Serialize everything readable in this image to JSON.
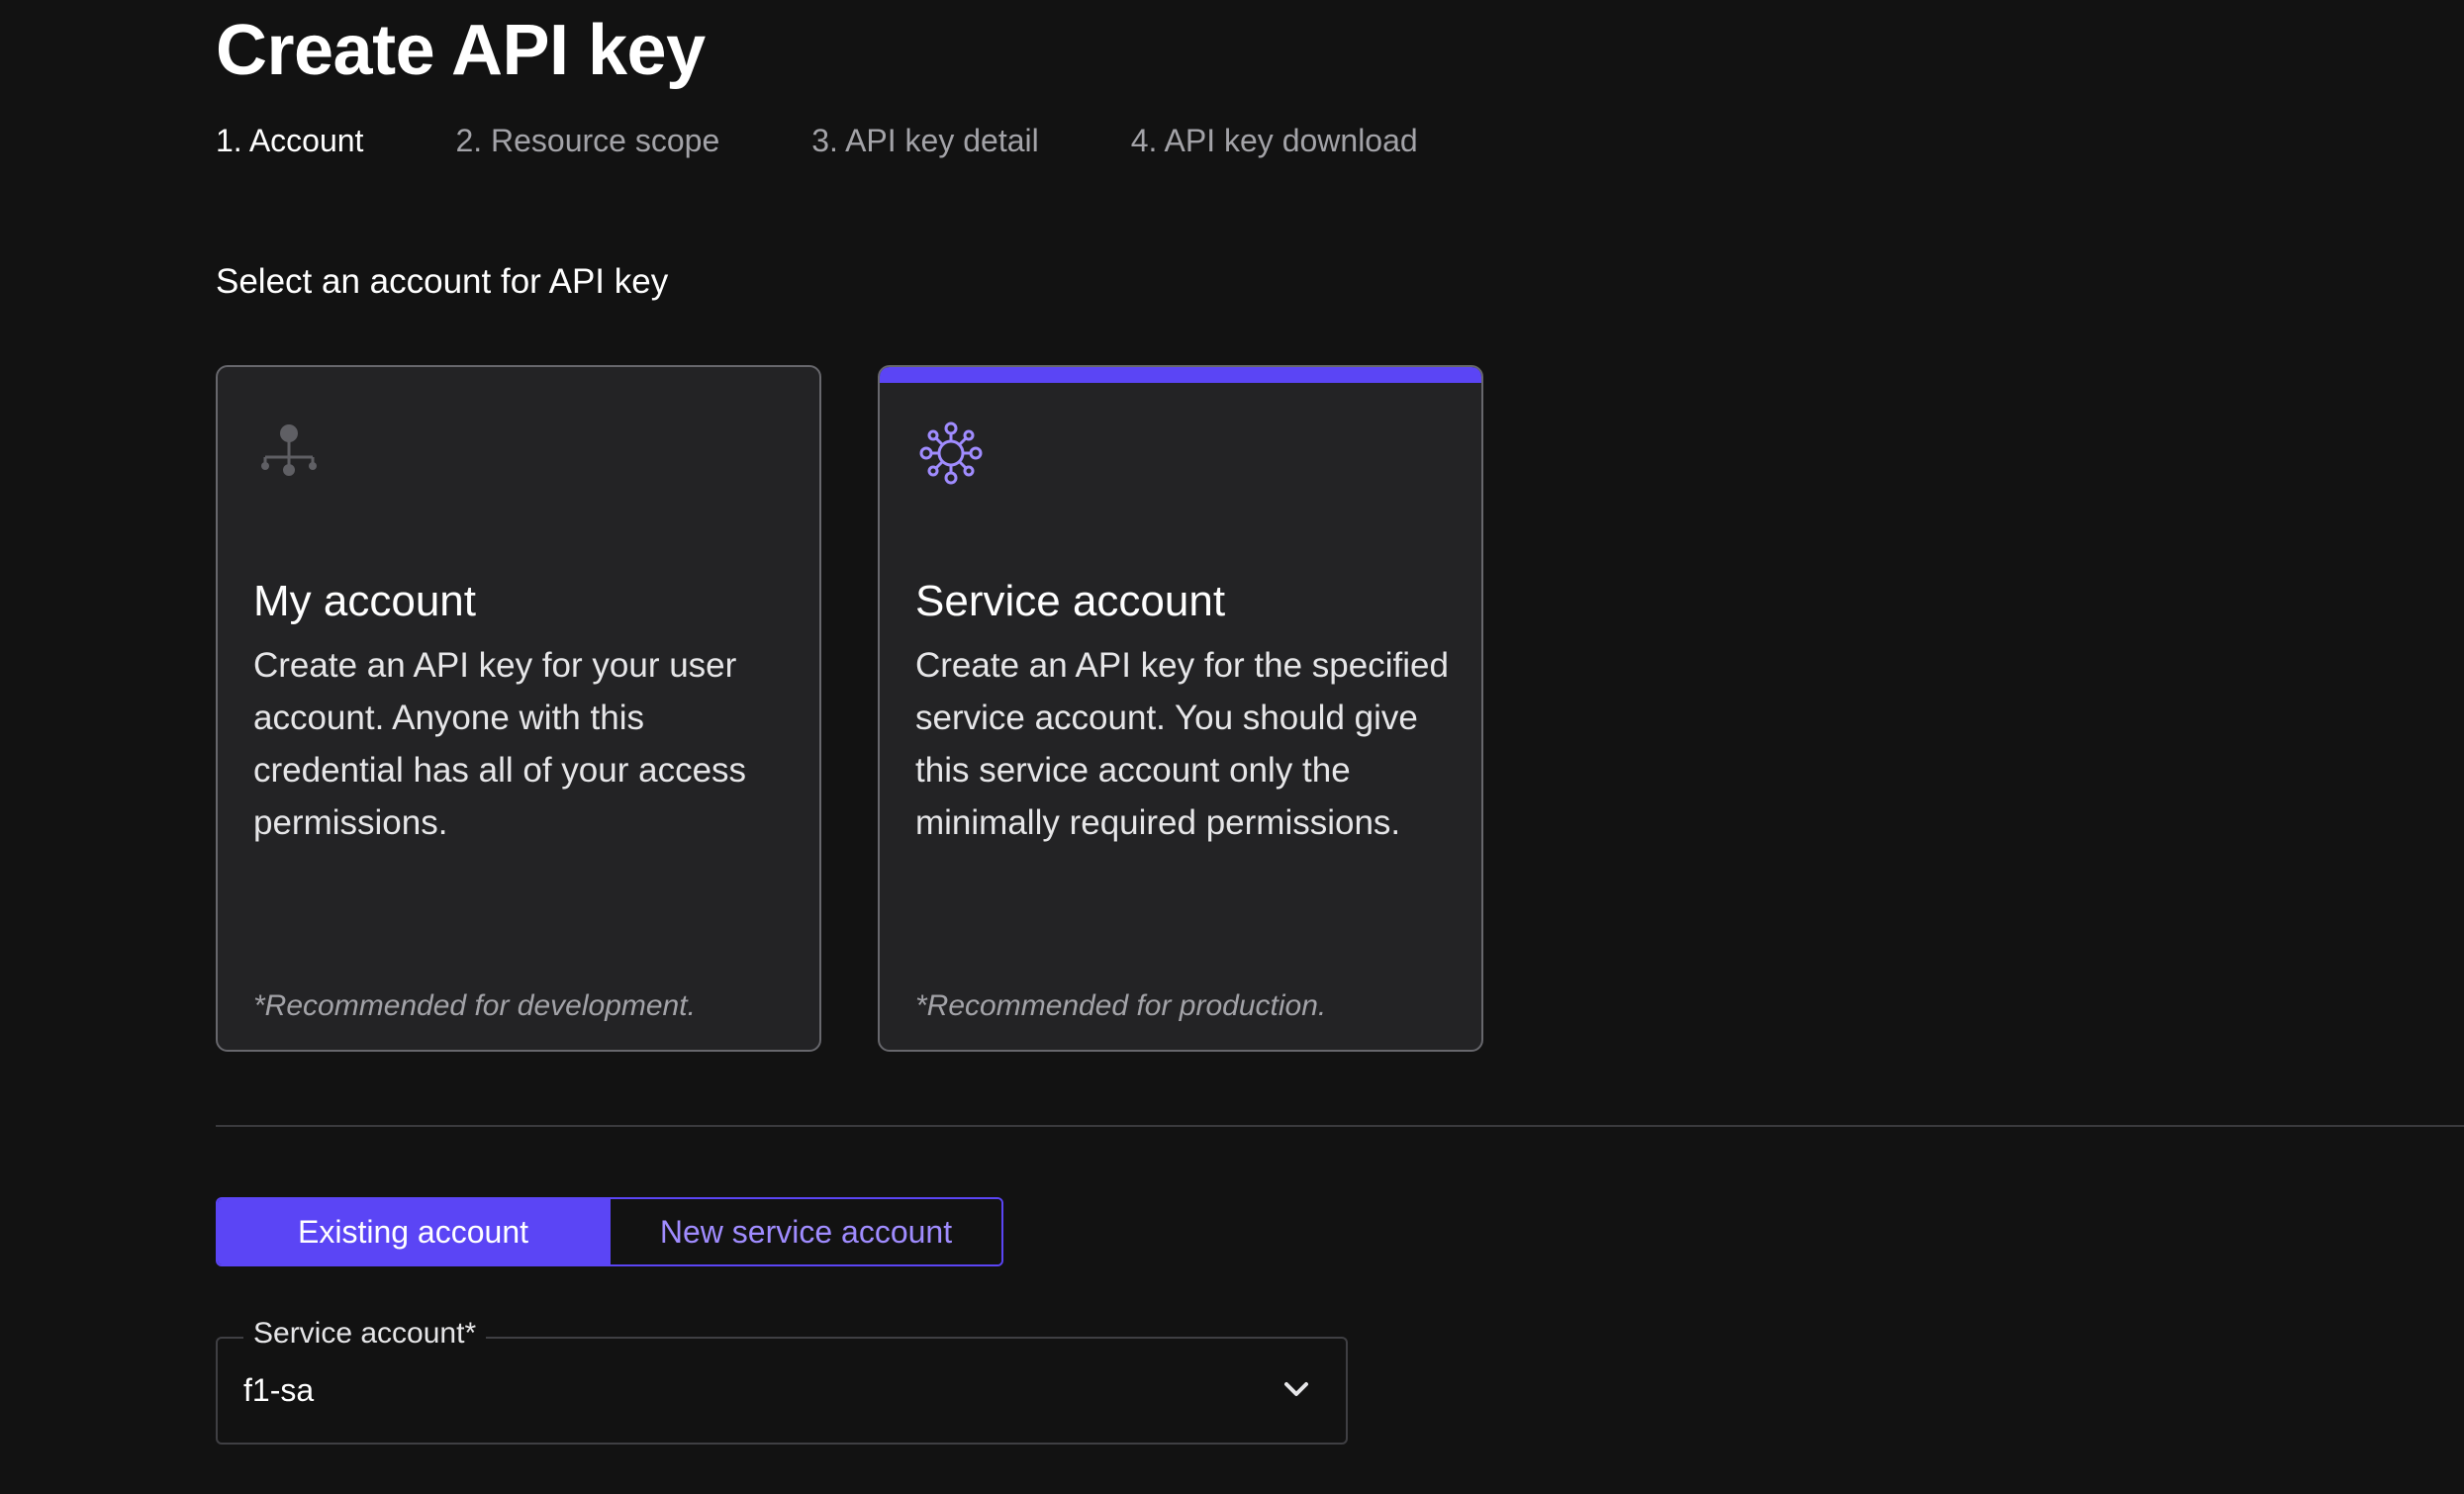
{
  "page": {
    "title": "Create API key"
  },
  "steps": [
    {
      "label": "1. Account",
      "active": true
    },
    {
      "label": "2. Resource scope",
      "active": false
    },
    {
      "label": "3. API key detail",
      "active": false
    },
    {
      "label": "4. API key download",
      "active": false
    }
  ],
  "section": {
    "heading": "Select an account for API key"
  },
  "cards": {
    "my_account": {
      "icon": "org-tree-icon",
      "title": "My account",
      "description": "Create an API key for your user account. Anyone with this credential has all of your access permissions.",
      "note": "*Recommended for development.",
      "selected": false
    },
    "service_account": {
      "icon": "service-network-icon",
      "title": "Service account",
      "description": "Create an API key for the specified service account. You should give this service account only the minimally required permissions.",
      "note": "*Recommended for production.",
      "selected": true
    }
  },
  "account_toggle": {
    "existing_label": "Existing account",
    "new_label": "New service account",
    "selected": "existing"
  },
  "service_account_select": {
    "label": "Service account*",
    "value": "f1-sa",
    "icon": "chevron-down-icon"
  },
  "colors": {
    "background": "#121212",
    "card_background": "#232325",
    "accent": "#5b45f5",
    "accent_text": "#a08cff",
    "muted_text": "#a3a3a8"
  }
}
